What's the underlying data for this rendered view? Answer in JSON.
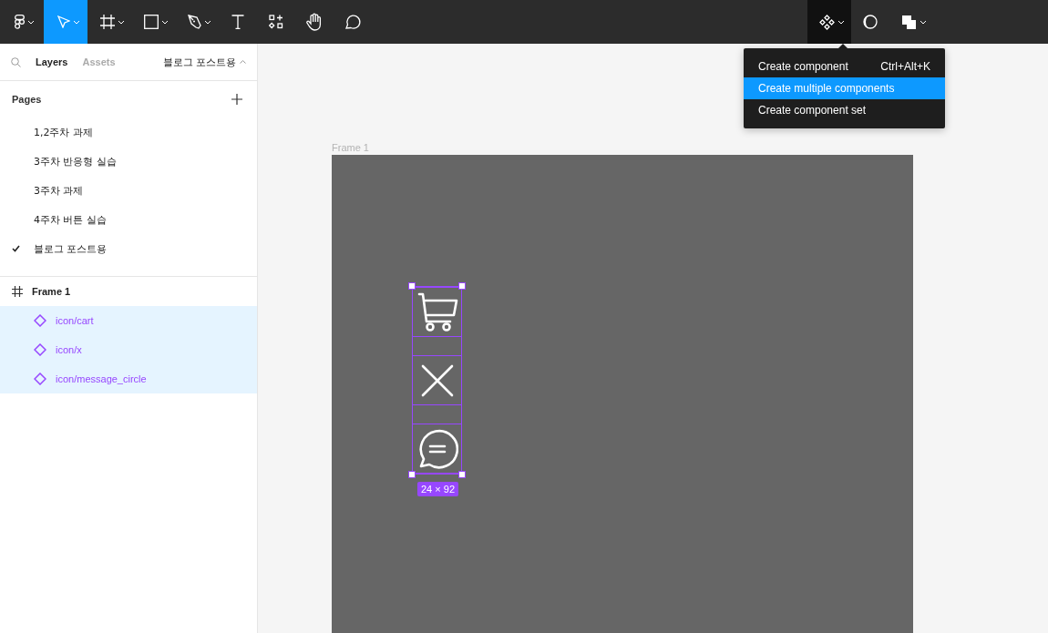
{
  "toolbar": {
    "left_tools": [
      {
        "kind": "logo",
        "selected": false,
        "menu": true
      },
      {
        "kind": "move",
        "selected": true,
        "menu": true
      },
      {
        "kind": "frame",
        "selected": false,
        "menu": true
      },
      {
        "kind": "rectangle",
        "selected": false,
        "menu": true
      },
      {
        "kind": "pen",
        "selected": false,
        "menu": true
      },
      {
        "kind": "text",
        "selected": false,
        "menu": false
      },
      {
        "kind": "resources",
        "selected": false,
        "menu": false
      },
      {
        "kind": "hand",
        "selected": false,
        "menu": false
      },
      {
        "kind": "comment",
        "selected": false,
        "menu": false
      }
    ],
    "right_tools": [
      {
        "kind": "component",
        "selected": true,
        "menu": true
      },
      {
        "kind": "mask",
        "selected": false,
        "menu": false
      },
      {
        "kind": "boolean",
        "selected": false,
        "menu": true
      }
    ]
  },
  "component_menu": {
    "items": [
      {
        "label": "Create component",
        "shortcut": "Ctrl+Alt+K",
        "selected": false
      },
      {
        "label": "Create multiple components",
        "selected": true
      },
      {
        "label": "Create component set",
        "selected": false
      }
    ]
  },
  "sidebar": {
    "tabs": [
      {
        "label": "Layers",
        "selected": true
      },
      {
        "label": "Assets",
        "selected": false
      }
    ],
    "current_page": "블로그 포스트용",
    "pages_title": "Pages",
    "pages": [
      {
        "label": "1,2주차 과제",
        "selected": false
      },
      {
        "label": "3주차 반응형 실습",
        "selected": false
      },
      {
        "label": "3주차 과제",
        "selected": false
      },
      {
        "label": "4주차 버튼 실습",
        "selected": false
      },
      {
        "label": "블로그 포스트용",
        "selected": true
      }
    ],
    "layers": [
      {
        "label": "Frame 1",
        "kind": "frame",
        "selected": false,
        "children": [
          {
            "label": "icon/cart",
            "kind": "component",
            "selected": true
          },
          {
            "label": "icon/x",
            "kind": "component",
            "selected": true
          },
          {
            "label": "icon/message_circle",
            "kind": "component",
            "selected": true
          }
        ]
      }
    ]
  },
  "canvas": {
    "frame_label": "Frame 1",
    "icons": [
      {
        "kind": "cart"
      },
      {
        "kind": "x"
      },
      {
        "kind": "message"
      }
    ],
    "size_label": "24 × 92"
  }
}
